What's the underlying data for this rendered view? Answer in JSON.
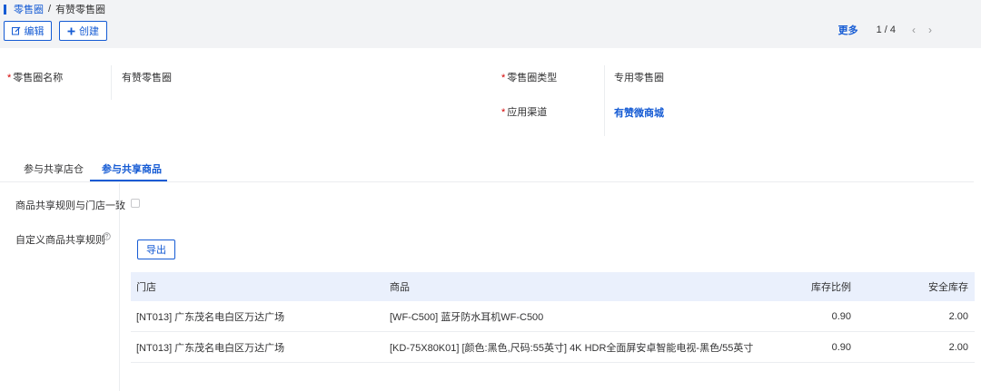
{
  "breadcrumb": {
    "parent": "零售圈",
    "separator": "/",
    "current": "有赞零售圈"
  },
  "toolbar": {
    "edit_label": "编辑",
    "create_label": "创建"
  },
  "pager": {
    "more_label": "更多",
    "page_text": "1 / 4",
    "prev": "‹",
    "next": "›"
  },
  "form": {
    "required_mark": "*",
    "name_label": "零售圈名称",
    "name_value": "有赞零售圈",
    "type_label": "零售圈类型",
    "type_value": "专用零售圈",
    "channel_label": "应用渠道",
    "channel_value": "有赞微商城"
  },
  "tabs": [
    {
      "label": "参与共享店仓",
      "active": false
    },
    {
      "label": "参与共享商品",
      "active": true
    }
  ],
  "settings": {
    "consistent_label": "商品共享规则与门店一致",
    "consistent_checked": false,
    "custom_label": "自定义商品共享规则"
  },
  "export_label": "导出",
  "table": {
    "headers": [
      "门店",
      "商品",
      "库存比例",
      "安全库存"
    ],
    "rows": [
      [
        "[NT013] 广东茂名电白区万达广场",
        "[WF-C500] 蓝牙防水耳机WF-C500",
        "0.90",
        "2.00"
      ],
      [
        "[NT013] 广东茂名电白区万达广场",
        "[KD-75X80K01] [颜色:黑色,尺码:55英寸] 4K HDR全面屏安卓智能电视-黑色/55英寸",
        "0.90",
        "2.00"
      ]
    ]
  },
  "colors": {
    "primary": "#155bd4",
    "required": "#d40000",
    "header_bg": "#eaf0fc",
    "topbar_bg": "#f2f3f5"
  },
  "icons": {
    "edit": "edit-icon",
    "create": "plus-icon",
    "help": "question-circle-icon"
  }
}
